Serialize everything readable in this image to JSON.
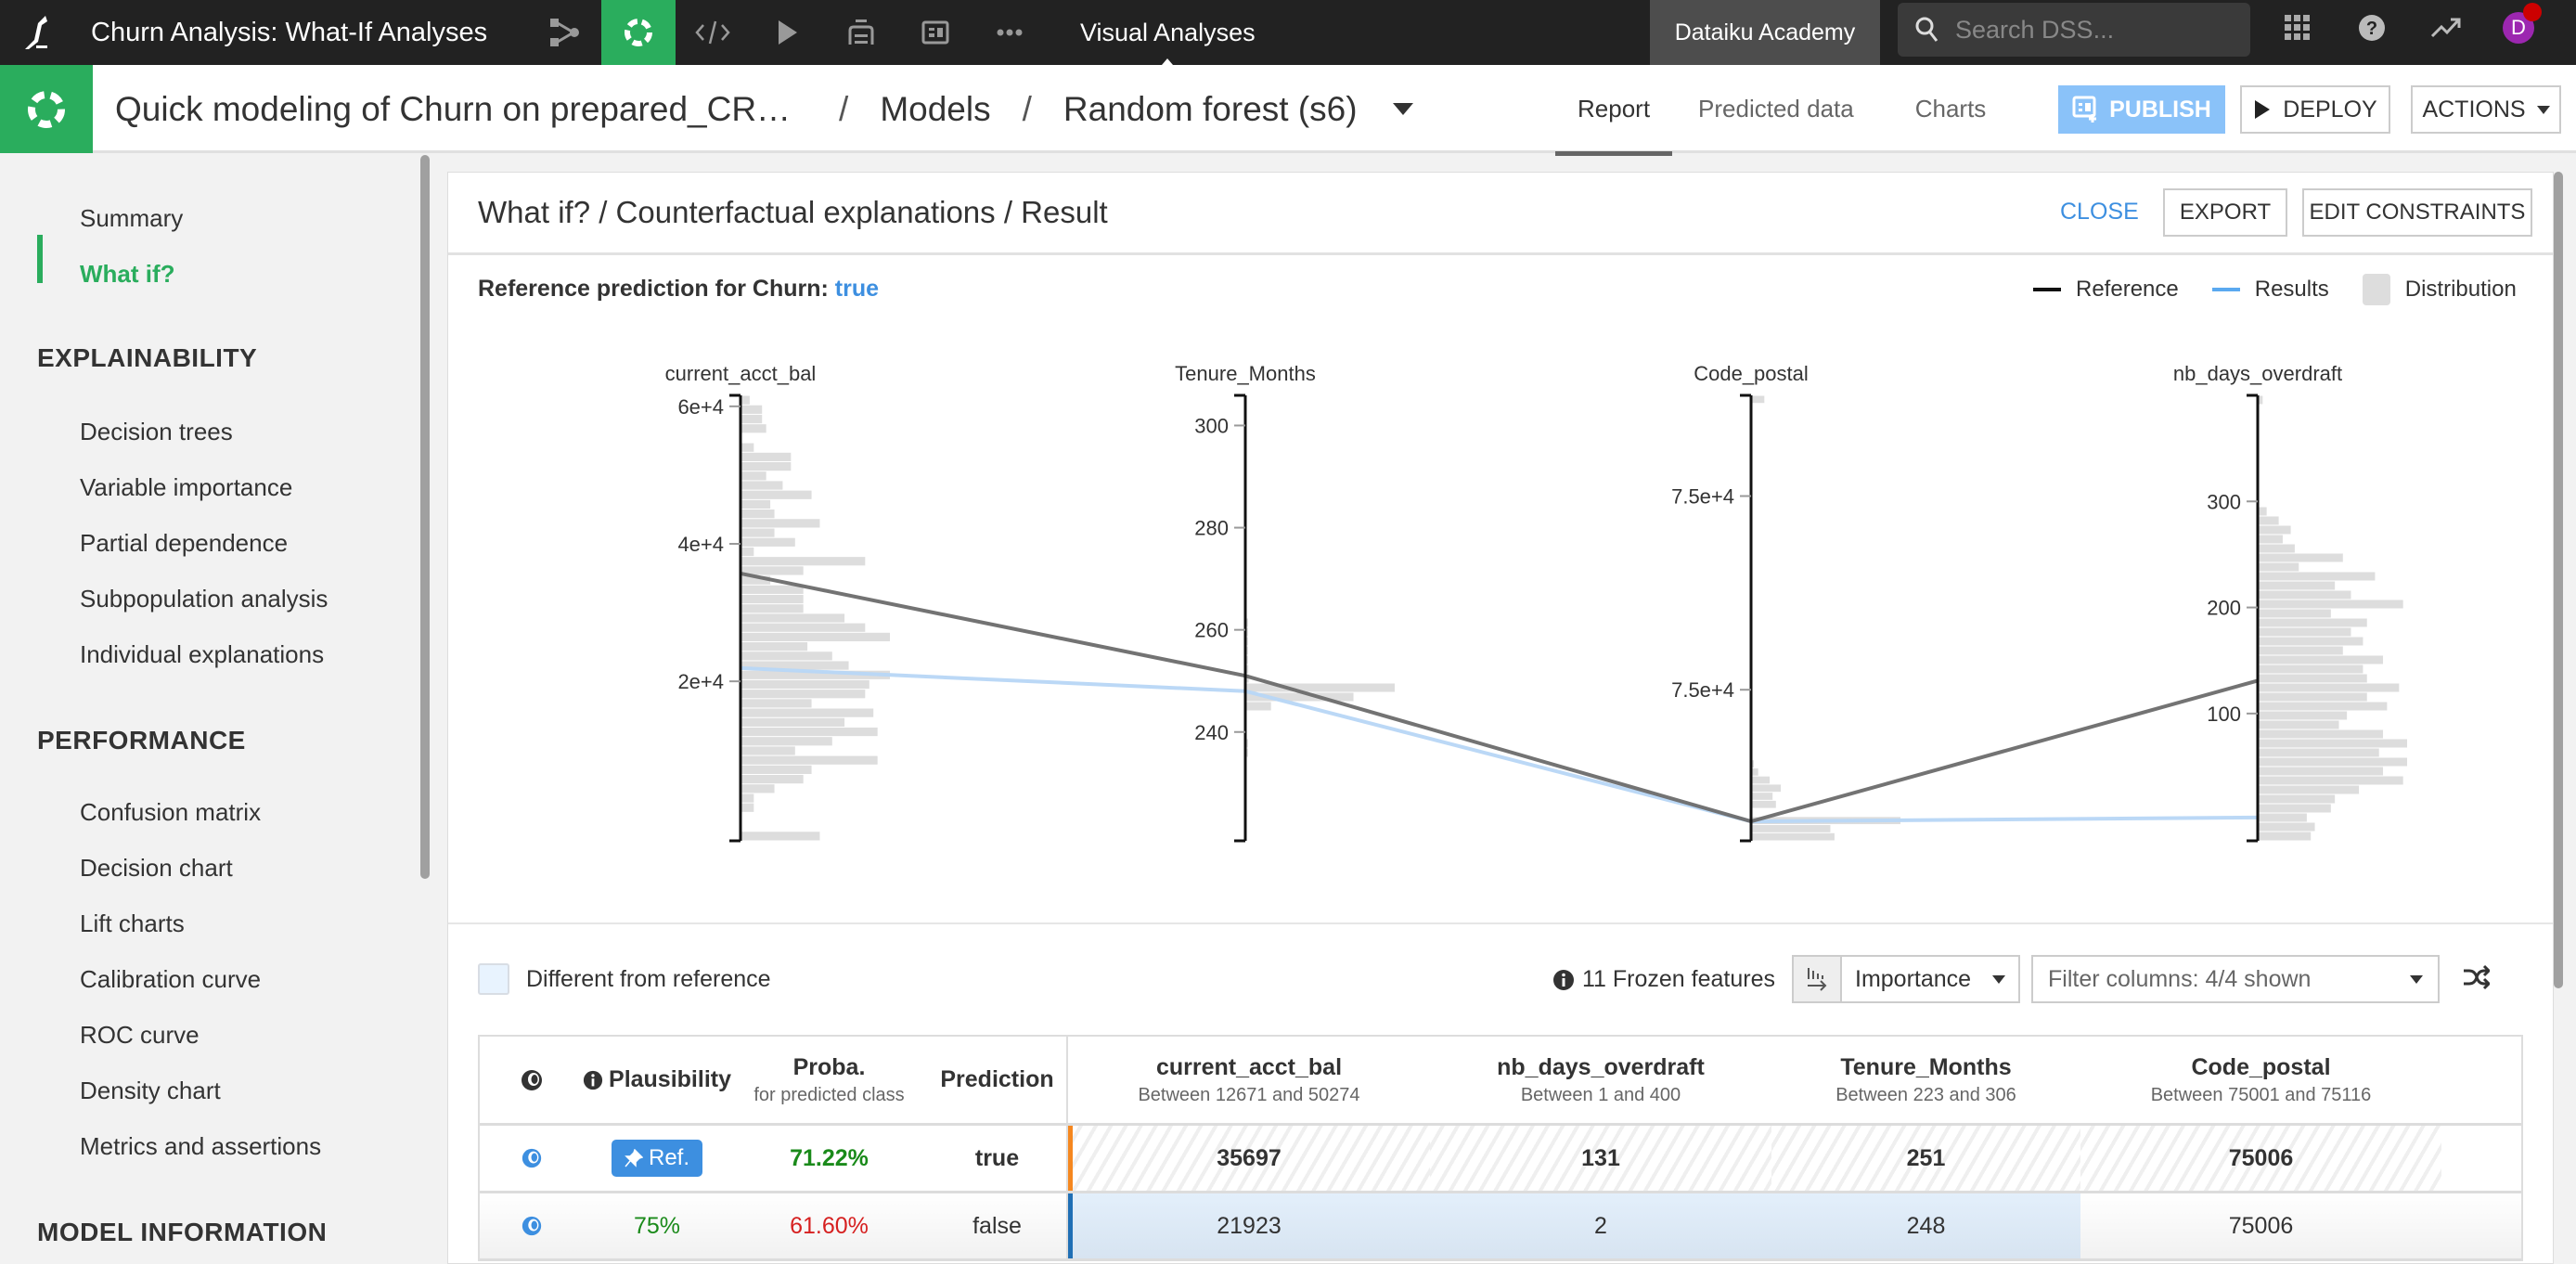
{
  "topbar": {
    "project_title": "Churn Analysis: What-If Analyses",
    "nav_icons": [
      "flow-icon",
      "lab-icon",
      "code-icon",
      "run-icon",
      "stack-icon",
      "dashboard-icon",
      "more-icon"
    ],
    "active_nav": "lab-icon",
    "section_label": "Visual Analyses",
    "academy_label": "Dataiku Academy",
    "search_placeholder": "Search DSS...",
    "right_icons": [
      "apps-grid-icon",
      "help-icon",
      "activity-icon"
    ],
    "avatar_initial": "D",
    "colors": {
      "brand_green": "#2aad5d",
      "avatar": "#9c27b0",
      "notification": "#cc0000"
    }
  },
  "subbar": {
    "breadcrumb": [
      "Quick modeling of Churn on prepared_CR…",
      "Models",
      "Random forest (s6)"
    ],
    "tabs": [
      {
        "label": "Report",
        "active": true
      },
      {
        "label": "Predicted data",
        "active": false
      },
      {
        "label": "Charts",
        "active": false
      }
    ],
    "publish_label": "PUBLISH",
    "deploy_label": "DEPLOY",
    "actions_label": "ACTIONS"
  },
  "sidebar": {
    "top_items": [
      {
        "label": "Summary",
        "active": false
      },
      {
        "label": "What if?",
        "active": true
      }
    ],
    "sections": [
      {
        "title": "EXPLAINABILITY",
        "items": [
          "Decision trees",
          "Variable importance",
          "Partial dependence",
          "Subpopulation analysis",
          "Individual explanations"
        ]
      },
      {
        "title": "PERFORMANCE",
        "items": [
          "Confusion matrix",
          "Decision chart",
          "Lift charts",
          "Calibration curve",
          "ROC curve",
          "Density chart",
          "Metrics and assertions"
        ]
      },
      {
        "title": "MODEL INFORMATION",
        "items": []
      }
    ]
  },
  "panel": {
    "title": "What if? / Counterfactual explanations / Result",
    "close_label": "CLOSE",
    "export_label": "EXPORT",
    "edit_constraints_label": "EDIT CONSTRAINTS",
    "reference_prediction_label": "Reference prediction for Churn:",
    "reference_prediction_value": "true",
    "legend": [
      {
        "label": "Reference",
        "color": "#111111",
        "kind": "line"
      },
      {
        "label": "Results",
        "color": "#5aa9f0",
        "kind": "line"
      },
      {
        "label": "Distribution",
        "color": "#dddddd",
        "kind": "box"
      }
    ]
  },
  "chart_data": {
    "type": "parallel-coordinates",
    "title": "",
    "axes": [
      {
        "name": "current_acct_bal",
        "range": [
          -3200,
          61600
        ],
        "ticks": [
          {
            "value": 60000,
            "label": "6e+4"
          },
          {
            "value": 40000,
            "label": "4e+4"
          },
          {
            "value": 20000,
            "label": "2e+4"
          }
        ],
        "histogram": [
          2,
          5,
          5,
          6,
          0,
          3,
          12,
          12,
          6,
          10,
          17,
          7,
          8,
          19,
          8,
          13,
          3,
          30,
          15,
          7,
          15,
          15,
          15,
          25,
          30,
          36,
          16,
          22,
          26,
          36,
          31,
          30,
          17,
          32,
          25,
          33,
          22,
          13,
          33,
          17,
          15,
          8,
          3,
          3,
          0,
          0,
          19
        ]
      },
      {
        "name": "Tenure_Months",
        "range": [
          218.7,
          305.9
        ],
        "ticks": [
          {
            "value": 300,
            "label": "300"
          },
          {
            "value": 280,
            "label": "280"
          },
          {
            "value": 260,
            "label": "260"
          },
          {
            "value": 240,
            "label": "240"
          }
        ],
        "histogram": [
          0,
          0,
          0,
          0,
          0,
          0,
          0,
          0,
          0,
          0,
          0,
          0,
          0,
          0,
          0,
          0,
          0,
          0,
          0,
          0,
          0,
          0,
          0,
          0,
          0.2,
          0.3,
          0.3,
          0.3,
          0.3,
          0.5,
          0.6,
          36,
          26,
          6,
          0,
          0,
          0,
          0.4,
          0.4,
          0,
          0,
          0,
          0,
          0,
          0,
          0,
          0,
          0
        ]
      },
      {
        "name": "Code_postal",
        "range": [
          75001,
          75116
        ],
        "ticks": [
          {
            "value": 75090,
            "label": "7.5e+4"
          },
          {
            "value": 75040,
            "label": "7.5e+4"
          }
        ],
        "histogram": [
          3,
          0,
          0,
          0,
          0,
          0,
          0,
          0,
          0,
          0,
          0,
          0,
          0,
          0,
          0,
          0,
          0,
          0,
          0,
          0,
          0,
          0,
          0,
          0,
          0,
          0,
          0,
          0,
          0,
          0,
          0,
          0,
          0,
          0,
          0,
          0,
          0,
          0,
          0,
          0,
          0,
          0,
          0,
          0,
          0,
          0.3,
          1.5,
          4.3,
          7,
          5,
          5.8,
          0,
          36,
          19,
          20
        ]
      },
      {
        "name": "nb_days_overdraft",
        "range": [
          -20,
          400
        ],
        "ticks": [
          {
            "value": 300,
            "label": "300"
          },
          {
            "value": 200,
            "label": "200"
          },
          {
            "value": 100,
            "label": "100"
          }
        ],
        "histogram": [
          1,
          0,
          0,
          0,
          0,
          0,
          0,
          0,
          0,
          0,
          0,
          0,
          2,
          5,
          8,
          6,
          9,
          21,
          10,
          29,
          19,
          23,
          36,
          18,
          27,
          23,
          26,
          21,
          31,
          26,
          27,
          35,
          27,
          32,
          22,
          20,
          31,
          37,
          30,
          37,
          31,
          36,
          25,
          19,
          18,
          12,
          14,
          13
        ]
      }
    ],
    "series": [
      {
        "name": "Reference",
        "values": {
          "current_acct_bal": 35697,
          "Tenure_Months": 251,
          "Code_postal": 75006,
          "nb_days_overdraft": 131
        }
      },
      {
        "name": "Results",
        "values": {
          "current_acct_bal": 21923,
          "Tenure_Months": 248,
          "Code_postal": 75006,
          "nb_days_overdraft": 2
        }
      }
    ],
    "legend": "top-right"
  },
  "controls": {
    "different_from_reference_label": "Different from reference",
    "different_from_reference_checked": false,
    "frozen_features_label": "11 Frozen features",
    "sort_value": "Importance",
    "filter_columns_value": "Filter columns: 4/4 shown"
  },
  "table": {
    "columns": [
      {
        "key": "eye",
        "label": ""
      },
      {
        "key": "plausibility",
        "label": "Plausibility"
      },
      {
        "key": "proba",
        "label": "Proba.",
        "sub": "for predicted class"
      },
      {
        "key": "prediction",
        "label": "Prediction"
      },
      {
        "key": "current_acct_bal",
        "label": "current_acct_bal",
        "sub": "Between 12671 and 50274"
      },
      {
        "key": "nb_days_overdraft",
        "label": "nb_days_overdraft",
        "sub": "Between 1 and 400"
      },
      {
        "key": "Tenure_Months",
        "label": "Tenure_Months",
        "sub": "Between 223 and 306"
      },
      {
        "key": "Code_postal",
        "label": "Code_postal",
        "sub": "Between 75001 and 75116"
      }
    ],
    "rows": [
      {
        "plausibility": "Ref.",
        "is_reference": true,
        "proba": "71.22%",
        "prediction": "true",
        "current_acct_bal": "35697",
        "nb_days_overdraft": "131",
        "Tenure_Months": "251",
        "Code_postal": "75006",
        "marker_color": "#f5871f"
      },
      {
        "plausibility": "75%",
        "is_reference": false,
        "proba": "61.60%",
        "prediction": "false",
        "current_acct_bal": "21923",
        "nb_days_overdraft": "2",
        "Tenure_Months": "248",
        "Code_postal": "75006",
        "marker_color": "#1f6fb5"
      }
    ]
  }
}
